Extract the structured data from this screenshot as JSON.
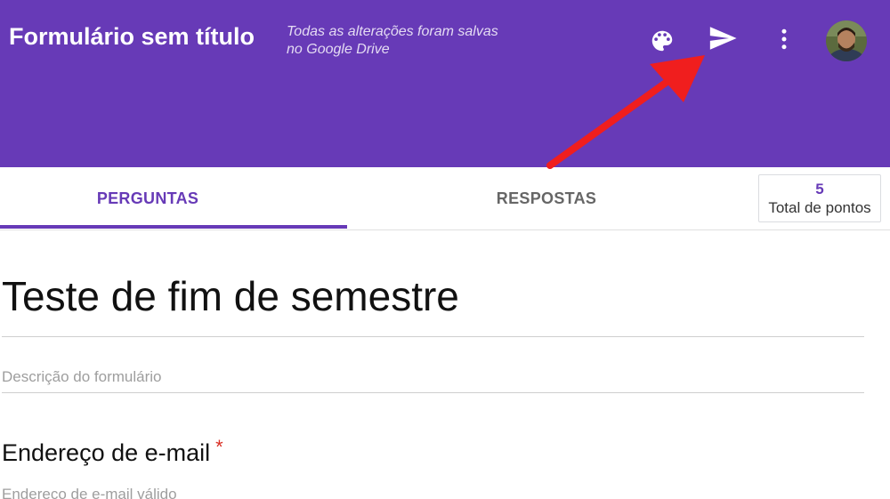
{
  "header": {
    "title": "Formulário sem título",
    "save_status": "Todas as alterações foram salvas no Google Drive",
    "icons": [
      "palette-icon",
      "send-icon",
      "more-vert-icon",
      "avatar"
    ],
    "colors": {
      "theme": "#673ab7",
      "annotation_arrow": "#f01e1e"
    }
  },
  "tabs": {
    "questions": "PERGUNTAS",
    "responses": "RESPOSTAS",
    "active": "PERGUNTAS"
  },
  "points": {
    "value": "5",
    "label": "Total de pontos"
  },
  "form": {
    "title": "Teste de fim de semestre",
    "description_placeholder": "Descrição do formulário",
    "question": {
      "title": "Endereço de e-mail",
      "required_mark": "*",
      "hint": "Endereço de e-mail válido"
    }
  }
}
